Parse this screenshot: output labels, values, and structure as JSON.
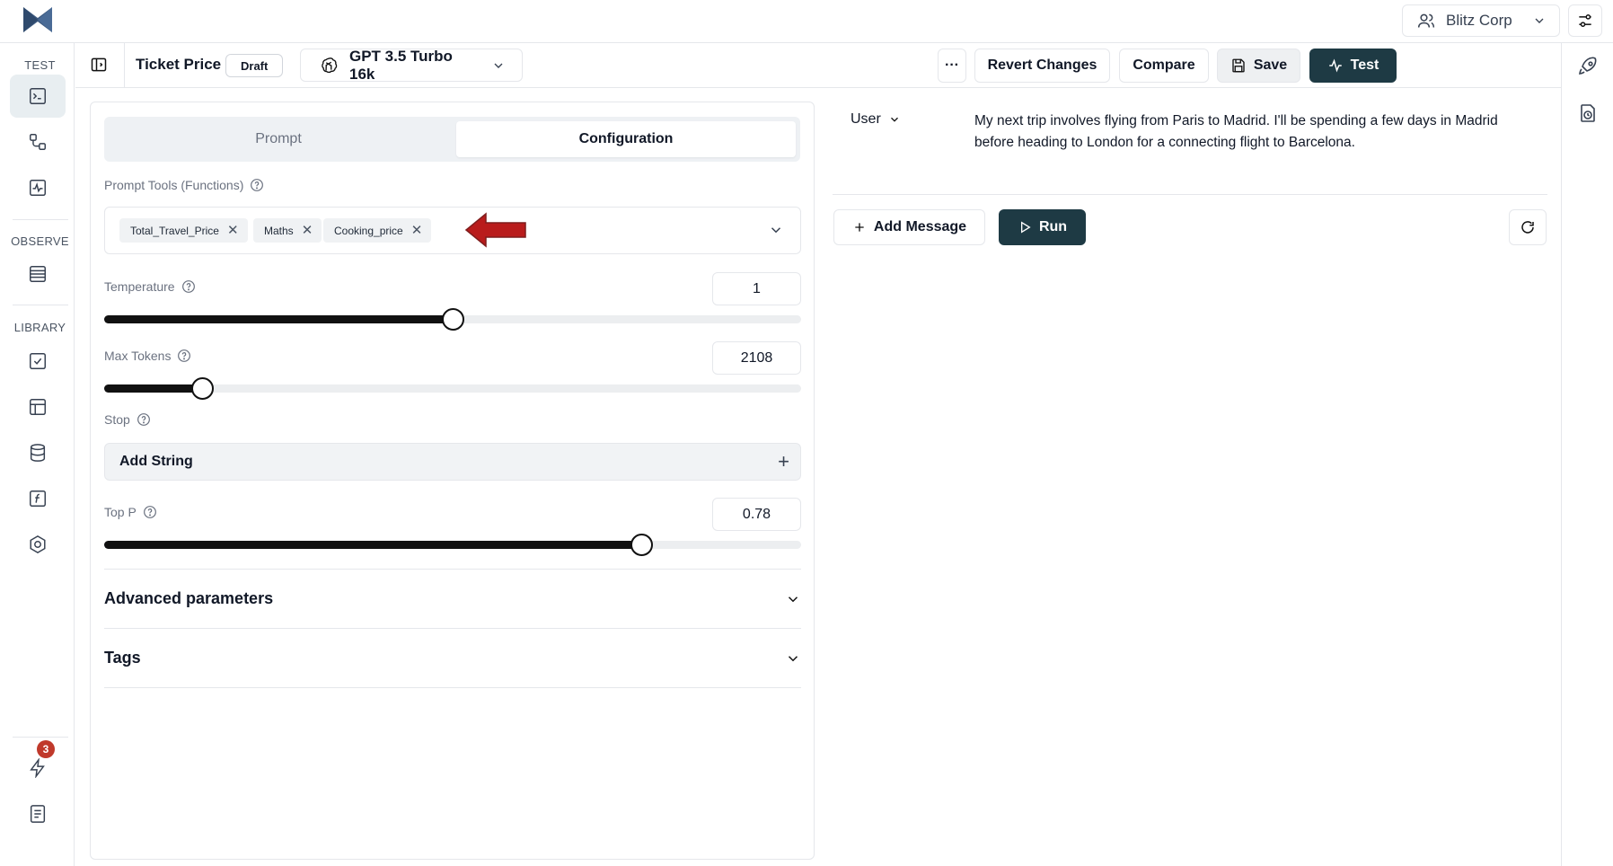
{
  "topbar": {
    "org_name": "Blitz Corp"
  },
  "nav": {
    "sections": [
      "TEST",
      "OBSERVE",
      "LIBRARY"
    ],
    "notification_count": "3"
  },
  "toolbar": {
    "title": "Ticket Price",
    "status": "Draft",
    "model": "GPT 3.5 Turbo 16k",
    "more_label": "···",
    "revert_label": "Revert Changes",
    "compare_label": "Compare",
    "save_label": "Save",
    "test_label": "Test"
  },
  "config": {
    "tabs": [
      {
        "label": "Prompt",
        "active": false
      },
      {
        "label": "Configuration",
        "active": true
      }
    ],
    "tools_label": "Prompt Tools (Functions)",
    "tools": [
      "Total_Travel_Price",
      "Maths",
      "Cooking_price"
    ],
    "temperature": {
      "label": "Temperature",
      "value": "1",
      "level": 0.5
    },
    "max_tokens": {
      "label": "Max Tokens",
      "value": "2108",
      "level": 0.14
    },
    "stop": {
      "label": "Stop",
      "add_label": "Add String"
    },
    "top_p": {
      "label": "Top P",
      "value": "0.78",
      "level": 0.77
    },
    "advanced_label": "Advanced parameters",
    "tags_label": "Tags"
  },
  "messages": {
    "role": "User",
    "text": "My next trip involves flying from Paris to Madrid. I'll be spending a few days in Madrid before heading to London for a connecting flight to Barcelona.",
    "add_label": "Add Message",
    "run_label": "Run"
  },
  "colors": {
    "primary_dark": "#1e3a44",
    "arrow": "#b91c1c",
    "badge": "#c0392b"
  }
}
